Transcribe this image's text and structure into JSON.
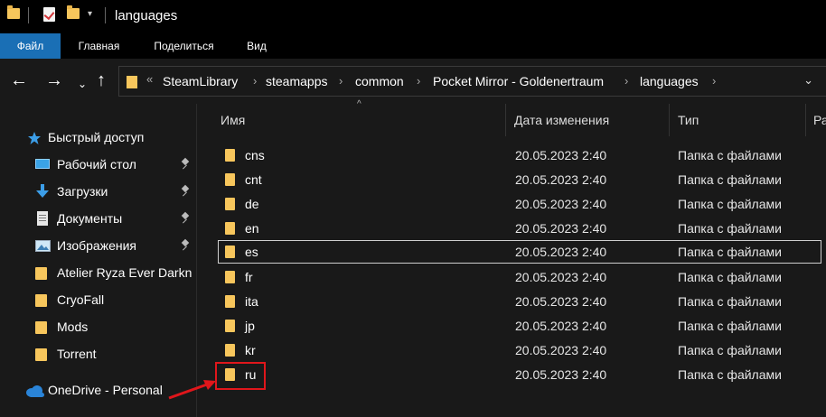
{
  "window": {
    "title": "languages"
  },
  "quick_access_toolbar": {
    "icons": [
      "folder-icon",
      "checkmark-properties-icon",
      "new-folder-icon",
      "dropdown-icon"
    ],
    "dropdown_glyph": "▾"
  },
  "ribbon": {
    "tabs": [
      {
        "label": "Файл",
        "active": true
      },
      {
        "label": "Главная"
      },
      {
        "label": "Поделиться"
      },
      {
        "label": "Вид"
      }
    ],
    "accent_color": "#1a6fb5"
  },
  "nav": {
    "back_glyph": "←",
    "forward_glyph": "→",
    "recent_glyph": "⌄",
    "up_glyph": "↑",
    "overflow_glyph": "«",
    "separator_glyph": "›",
    "dropdown_glyph": "⌄",
    "breadcrumbs": [
      "SteamLibrary",
      "steamapps",
      "common",
      "Pocket Mirror - Goldenertraum",
      "languages"
    ]
  },
  "sidebar": {
    "quick_access": {
      "label": "Быстрый доступ",
      "icon": "star-icon"
    },
    "items": [
      {
        "label": "Рабочий стол",
        "icon": "desktop-icon",
        "pinned": true
      },
      {
        "label": "Загрузки",
        "icon": "download-icon",
        "pinned": true
      },
      {
        "label": "Документы",
        "icon": "documents-icon",
        "pinned": true
      },
      {
        "label": "Изображения",
        "icon": "pictures-icon",
        "pinned": true
      },
      {
        "label": "Atelier Ryza Ever Darkn",
        "icon": "folder-icon"
      },
      {
        "label": "CryoFall",
        "icon": "folder-icon"
      },
      {
        "label": "Mods",
        "icon": "folder-icon"
      },
      {
        "label": "Torrent",
        "icon": "folder-icon"
      }
    ],
    "onedrive": {
      "label": "OneDrive - Personal",
      "icon": "cloud-icon"
    }
  },
  "columns": {
    "name": "Имя",
    "date": "Дата изменения",
    "type": "Тип",
    "size": "Ра"
  },
  "files": [
    {
      "name": "cns",
      "date": "20.05.2023 2:40",
      "type": "Папка с файлами"
    },
    {
      "name": "cnt",
      "date": "20.05.2023 2:40",
      "type": "Папка с файлами"
    },
    {
      "name": "de",
      "date": "20.05.2023 2:40",
      "type": "Папка с файлами"
    },
    {
      "name": "en",
      "date": "20.05.2023 2:40",
      "type": "Папка с файлами"
    },
    {
      "name": "es",
      "date": "20.05.2023 2:40",
      "type": "Папка с файлами",
      "focused": true
    },
    {
      "name": "fr",
      "date": "20.05.2023 2:40",
      "type": "Папка с файлами"
    },
    {
      "name": "ita",
      "date": "20.05.2023 2:40",
      "type": "Папка с файлами"
    },
    {
      "name": "jp",
      "date": "20.05.2023 2:40",
      "type": "Папка с файлами"
    },
    {
      "name": "kr",
      "date": "20.05.2023 2:40",
      "type": "Папка с файлами"
    },
    {
      "name": "ru",
      "date": "20.05.2023 2:40",
      "type": "Папка с файлами",
      "highlighted": true
    }
  ],
  "annotation": {
    "color": "#e0161b"
  }
}
